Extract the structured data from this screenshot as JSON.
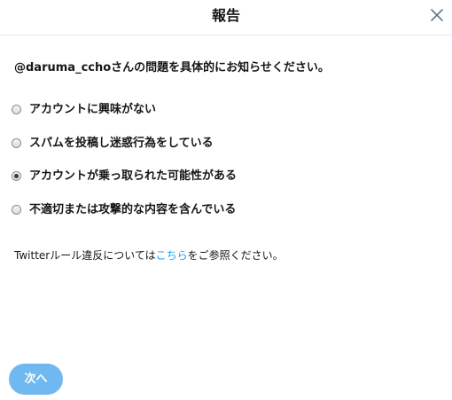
{
  "dialog": {
    "title": "報告",
    "close_icon": "close-icon"
  },
  "question": "@daruma_cchoさんの問題を具体的にお知らせください。",
  "options": [
    {
      "label": "アカウントに興味がない",
      "checked": false
    },
    {
      "label": "スパムを投稿し迷惑行為をしている",
      "checked": false
    },
    {
      "label": "アカウントが乗っ取られた可能性がある",
      "checked": true
    },
    {
      "label": "不適切または攻撃的な内容を含んでいる",
      "checked": false
    }
  ],
  "footer": {
    "prefix": "Twitterルール違反については",
    "link": "こちら",
    "suffix": "をご参照ください。"
  },
  "next_button": "次へ",
  "colors": {
    "accent": "#1da1f2",
    "button_bg": "#6fb8f0",
    "text": "#14171a",
    "divider": "#e6ecf0"
  }
}
